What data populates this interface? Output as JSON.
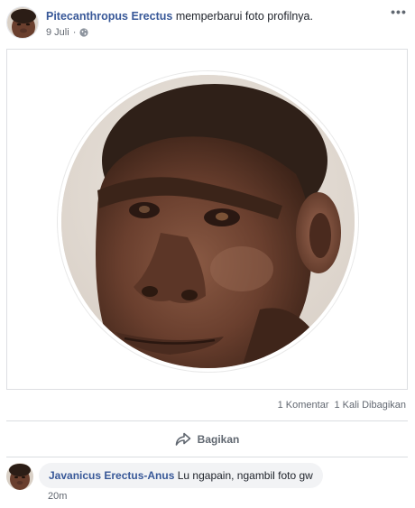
{
  "post": {
    "author": "Pitecanthropus Erectus",
    "action": "memperbarui foto profilnya.",
    "date": "9 Juli",
    "privacy_icon": "globe-icon",
    "more_icon": "more-options-icon",
    "more_glyph": "•••"
  },
  "stats": {
    "comments": "1 Komentar",
    "shares": "1 Kali Dibagikan"
  },
  "actions": {
    "share_label": "Bagikan",
    "share_icon": "share-icon"
  },
  "comment": {
    "author": "Javanicus Erectus-Anus",
    "text": "Lu ngapain, ngambil foto gw",
    "time": "20m"
  },
  "colors": {
    "link": "#385898",
    "text": "#1d2129",
    "muted": "#616770",
    "bubble": "#f2f3f5",
    "divider": "#dadde1"
  }
}
